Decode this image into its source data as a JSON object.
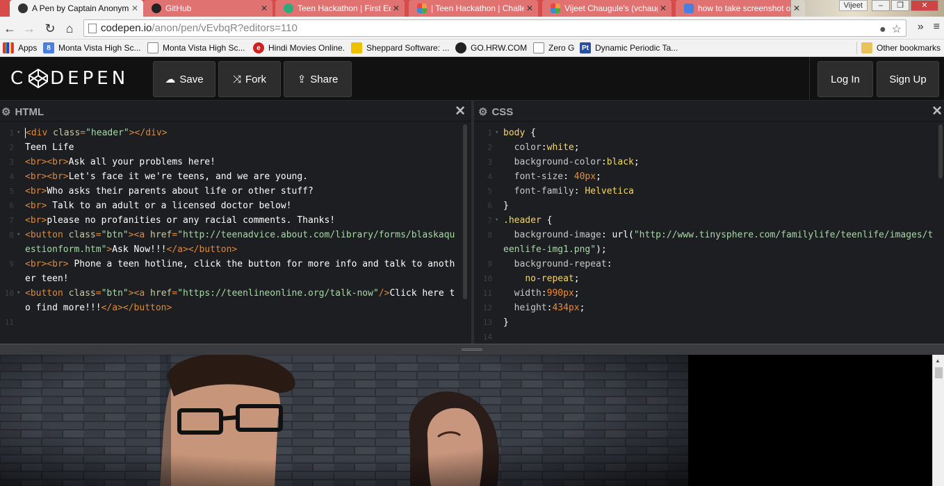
{
  "browser": {
    "tabs": [
      {
        "title": "A Pen by Captain Anonym",
        "active": true,
        "favicon": "codepen-icon",
        "color": "#333333"
      },
      {
        "title": "GitHub",
        "active": false,
        "favicon": "github-icon",
        "color": "#222222"
      },
      {
        "title": "Teen Hackathon | First Ed",
        "active": false,
        "favicon": "hackathon-icon",
        "color": "#2eaa7a"
      },
      {
        "title": "| Teen Hackathon | Challe",
        "active": false,
        "favicon": "pinwheel-icon",
        "color": "#e06030"
      },
      {
        "title": "Vijeet Chaugule's (vchaug",
        "active": false,
        "favicon": "pinwheel-icon",
        "color": "#e06030"
      },
      {
        "title": "how to take screenshot o",
        "active": false,
        "favicon": "google-icon",
        "color": "#4a7fe0"
      }
    ],
    "user_name": "Vijeet",
    "window_controls": [
      "‒",
      "❐",
      "✕"
    ],
    "address_host": "codepen.io",
    "address_path": "/anon/pen/vEvbqR?editors=110",
    "bookmarks": [
      {
        "label": "Apps",
        "icon": "apps-icon"
      },
      {
        "label": "Monta Vista High Sc...",
        "icon": "google-icon"
      },
      {
        "label": "Monta Vista High Sc...",
        "icon": "page-icon"
      },
      {
        "label": "Hindi Movies Online.",
        "icon": "e-icon"
      },
      {
        "label": "Sheppard Software: ...",
        "icon": "sheppard-icon"
      },
      {
        "label": "GO.HRW.COM",
        "icon": "hrw-icon"
      },
      {
        "label": "Zero G",
        "icon": "page-icon"
      },
      {
        "label": "Dynamic Periodic Ta...",
        "icon": "pt-icon"
      },
      {
        "label": "Other bookmarks",
        "icon": "folder-icon"
      }
    ]
  },
  "codepen": {
    "logo_text_left": "C",
    "logo_text_right": "DEPEN",
    "buttons": {
      "save": "Save",
      "fork": "Fork",
      "share": "Share",
      "login": "Log In",
      "signup": "Sign Up"
    }
  },
  "editors": {
    "html": {
      "title": "HTML",
      "lines": [
        {
          "n": "1",
          "fold": true,
          "segments": [
            [
              "tag",
              "<div "
            ],
            [
              "attr",
              "class"
            ],
            [
              "tag",
              "="
            ],
            [
              "str",
              "\"header\""
            ],
            [
              "tag",
              "></div>"
            ]
          ]
        },
        {
          "n": "2",
          "segments": [
            [
              "plain",
              "Teen Life"
            ]
          ]
        },
        {
          "n": "3",
          "segments": [
            [
              "tag",
              "<br><br>"
            ],
            [
              "plain",
              "Ask all your problems here!"
            ]
          ]
        },
        {
          "n": "4",
          "segments": [
            [
              "tag",
              "<br><br>"
            ],
            [
              "plain",
              "Let's face it we're teens, and we are young."
            ]
          ]
        },
        {
          "n": "5",
          "segments": [
            [
              "tag",
              "<br>"
            ],
            [
              "plain",
              "Who asks their parents about life or other stuff?"
            ]
          ]
        },
        {
          "n": "6",
          "segments": [
            [
              "tag",
              "<br>"
            ],
            [
              "plain",
              " Talk to an adult or a licensed doctor below!"
            ]
          ]
        },
        {
          "n": "7",
          "segments": [
            [
              "tag",
              "<br>"
            ],
            [
              "plain",
              "please no profanities or any racial comments. Thanks!"
            ]
          ]
        },
        {
          "n": "8",
          "fold": true,
          "segments": [
            [
              "tag",
              "<button "
            ],
            [
              "attr",
              "class"
            ],
            [
              "tag",
              "="
            ],
            [
              "str",
              "\"btn\""
            ],
            [
              "tag",
              "><a "
            ],
            [
              "attr",
              "href"
            ],
            [
              "tag",
              "="
            ],
            [
              "str",
              "\"http://teenadvice.about.com/library/forms/blaskaquestionform.htm\""
            ],
            [
              "tag",
              ">"
            ],
            [
              "plain",
              "Ask Now!!!"
            ],
            [
              "tag",
              "</a></button>"
            ]
          ]
        },
        {
          "n": "9",
          "segments": [
            [
              "tag",
              "<br><br>"
            ],
            [
              "plain",
              " Phone a teen hotline, click the button for more info and talk to another teen!"
            ]
          ]
        },
        {
          "n": "10",
          "fold": true,
          "segments": [
            [
              "tag",
              "<button "
            ],
            [
              "attr",
              "class"
            ],
            [
              "tag",
              "="
            ],
            [
              "str",
              "\"btn\""
            ],
            [
              "tag",
              "><a "
            ],
            [
              "attr",
              "href"
            ],
            [
              "tag",
              "="
            ],
            [
              "str",
              "\"https://teenlineonline.org/talk-now\""
            ],
            [
              "tag",
              "/>"
            ],
            [
              "plain",
              "Click here to find more!!!"
            ],
            [
              "tag",
              "</a></button>"
            ]
          ]
        },
        {
          "n": "11",
          "segments": []
        }
      ]
    },
    "css": {
      "title": "CSS",
      "lines": [
        {
          "n": "1",
          "fold": true,
          "segments": [
            [
              "sel",
              "body "
            ],
            [
              "plain",
              "{"
            ]
          ]
        },
        {
          "n": "2",
          "segments": [
            [
              "prop",
              "  color"
            ],
            [
              "plain",
              ":"
            ],
            [
              "cval",
              "white"
            ],
            [
              "plain",
              ";"
            ]
          ]
        },
        {
          "n": "3",
          "segments": [
            [
              "prop",
              "  background-color"
            ],
            [
              "plain",
              ":"
            ],
            [
              "cval",
              "black"
            ],
            [
              "plain",
              ";"
            ]
          ]
        },
        {
          "n": "4",
          "segments": [
            [
              "prop",
              "  font-size"
            ],
            [
              "plain",
              ": "
            ],
            [
              "num",
              "40px"
            ],
            [
              "plain",
              ";"
            ]
          ]
        },
        {
          "n": "5",
          "segments": [
            [
              "prop",
              "  font-family"
            ],
            [
              "plain",
              ": "
            ],
            [
              "cval",
              "Helvetica"
            ]
          ]
        },
        {
          "n": "6",
          "segments": [
            [
              "plain",
              "}"
            ]
          ]
        },
        {
          "n": "7",
          "fold": true,
          "segments": [
            [
              "sel",
              ".header "
            ],
            [
              "plain",
              "{"
            ]
          ]
        },
        {
          "n": "8",
          "segments": [
            [
              "prop",
              "  background-image"
            ],
            [
              "plain",
              ": url("
            ],
            [
              "str",
              "\"http://www.tinysphere.com/familylife/teenlife/images/teenlife-img1.png\""
            ],
            [
              "plain",
              ");"
            ]
          ]
        },
        {
          "n": "9",
          "segments": [
            [
              "prop",
              "  background-repeat"
            ],
            [
              "plain",
              ":"
            ]
          ]
        },
        {
          "n": "10",
          "segments": [
            [
              "cval",
              "    no-repeat"
            ],
            [
              "plain",
              ";"
            ]
          ]
        },
        {
          "n": "11",
          "segments": [
            [
              "prop",
              "  width"
            ],
            [
              "plain",
              ":"
            ],
            [
              "num",
              "990px"
            ],
            [
              "plain",
              ";"
            ]
          ]
        },
        {
          "n": "12",
          "segments": [
            [
              "prop",
              "  height"
            ],
            [
              "plain",
              ":"
            ],
            [
              "num",
              "434px"
            ],
            [
              "plain",
              ";"
            ]
          ]
        },
        {
          "n": "13",
          "segments": [
            [
              "plain",
              "}"
            ]
          ]
        },
        {
          "n": "14",
          "segments": []
        }
      ]
    }
  },
  "preview": {
    "description_icon": "teen-couple-photo"
  }
}
